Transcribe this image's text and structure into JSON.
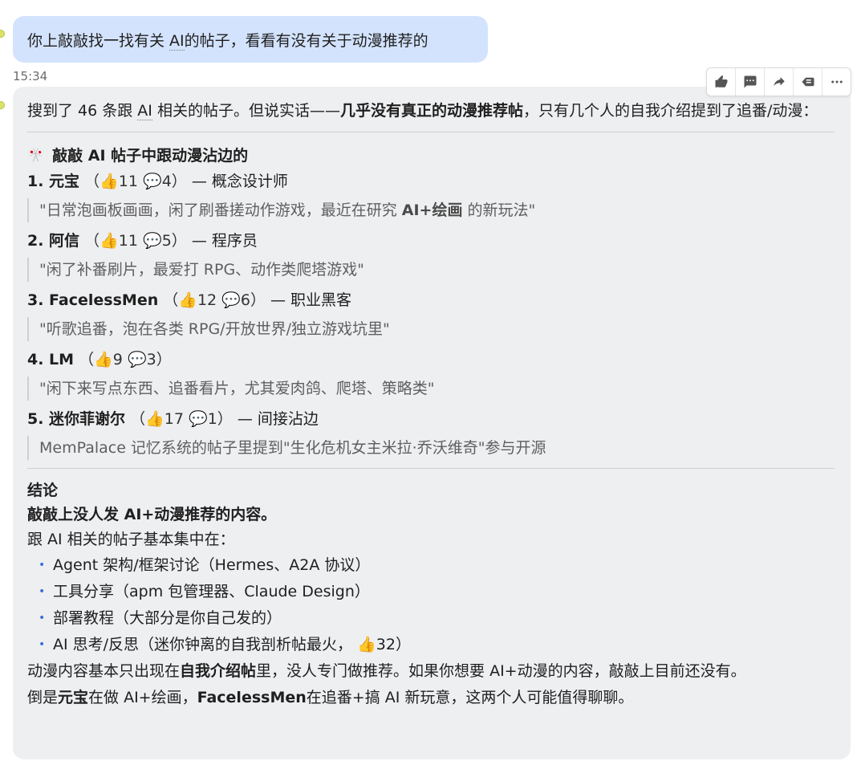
{
  "user_message": {
    "part1": "你上敲敲找一找有关 ",
    "ai_word": "AI",
    "part2": "的帖子，看看有没有关于动漫推荐的"
  },
  "timestamp": "15:34",
  "toolbar": {
    "icons": [
      "thumbs-up-icon",
      "comment-icon",
      "share-icon",
      "reply-icon",
      "more-icon"
    ]
  },
  "reply": {
    "intro_a": "搜到了 46 条跟 ",
    "intro_ai": "AI",
    "intro_b": " 相关的帖子。但说实话——",
    "intro_bold": "几乎没有真正的动漫推荐帖",
    "intro_c": "，只有几个人的自我介绍提到了追番/动漫：",
    "heading_emoji": "🎌",
    "heading": "敲敲 AI 帖子中跟动漫沾边的",
    "items": [
      {
        "name": "1. 元宝",
        "likes": "11",
        "comments": "4",
        "role": " — 概念设计师",
        "quote_a": "\"日常泡画板画画，闲了刷番搓动作游戏，最近在研究 ",
        "quote_bold": "AI+绘画",
        "quote_b": " 的新玩法\""
      },
      {
        "name": "2. 阿信",
        "likes": "11",
        "comments": "5",
        "role": " — 程序员",
        "quote_a": "\"闲了补番刷片，最爱打 RPG、动作类爬塔游戏\"",
        "quote_bold": "",
        "quote_b": ""
      },
      {
        "name": "3. FacelessMen",
        "likes": "12",
        "comments": "6",
        "role": " — 职业黑客",
        "quote_a": "\"听歌追番，泡在各类 RPG/开放世界/独立游戏坑里\"",
        "quote_bold": "",
        "quote_b": ""
      },
      {
        "name": "4. LM",
        "likes": "9",
        "comments": "3",
        "role": "",
        "quote_a": "\"闲下来写点东西、追番看片，尤其爱肉鸽、爬塔、策略类\"",
        "quote_bold": "",
        "quote_b": ""
      },
      {
        "name": "5. 迷你菲谢尔",
        "likes": "17",
        "comments": "1",
        "role": " — 间接沾边",
        "quote_a": "MemPalace 记忆系统的帖子里提到\"生化危机女主米拉·乔沃维奇\"参与开源",
        "quote_bold": "",
        "quote_b": ""
      }
    ],
    "conclusion_title": "结论",
    "conclusion_bold": "敲敲上没人发 AI+动漫推荐的内容。",
    "conclusion_line": "跟 AI 相关的帖子基本集中在：",
    "bullets": [
      "Agent 架构/框架讨论（Hermes、A2A 协议）",
      "工具分享（apm 包管理器、Claude Design）",
      "部署教程（大部分是你自己发的）"
    ],
    "bullet_last_a": "AI 思考/反思（迷你钟离的自我剖析帖最火，",
    "bullet_last_likes": "32",
    "bullet_last_b": "）",
    "closing1_a": "动漫内容基本只出现在",
    "closing1_bold": "自我介绍帖",
    "closing1_b": "里，没人专门做推荐。如果你想要 AI+动漫的内容，敲敲上目前还没有。",
    "closing2_a": "倒是",
    "closing2_bold1": "元宝",
    "closing2_b": "在做 AI+绘画，",
    "closing2_bold2": "FacelessMen",
    "closing2_c": "在追番+搞 AI 新玩意，这两个人可能值得聊聊。"
  }
}
